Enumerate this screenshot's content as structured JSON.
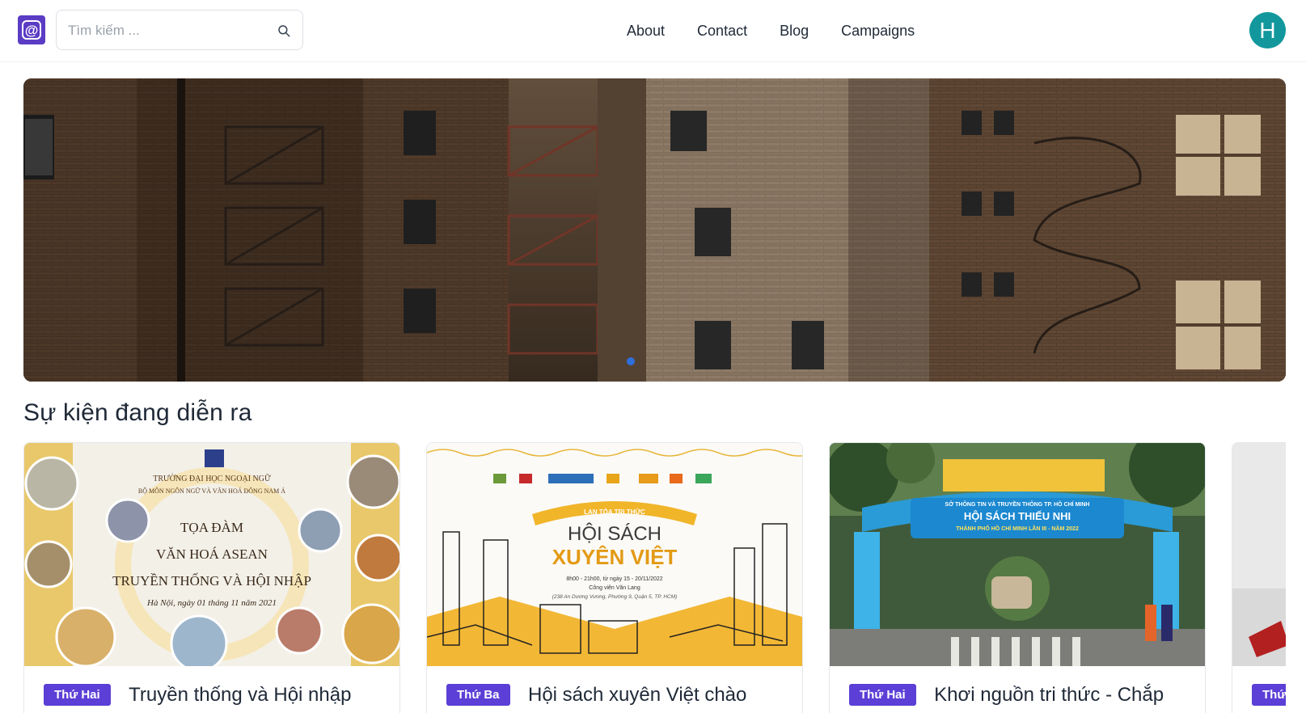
{
  "header": {
    "logo_symbol": "@",
    "search_placeholder": "Tìm kiếm ...",
    "nav": [
      "About",
      "Contact",
      "Blog",
      "Campaigns"
    ],
    "avatar_initial": "H",
    "brand_color": "#5b3cc4",
    "avatar_color": "#12989c"
  },
  "hero": {
    "image": "brick-apartment-buildings-fire-escapes",
    "active_slide": 1
  },
  "section": {
    "title": "Sự kiện đang diễn ra"
  },
  "cards": [
    {
      "day": "Thứ Hai",
      "title": "Truyền thống và Hội nhập",
      "poster": {
        "school": "TRƯỜNG ĐẠI HỌC NGOẠI NGỮ",
        "dept": "BỘ MÔN NGÔN NGỮ VÀ VĂN HOÁ ĐÔNG NAM Á",
        "line1": "TỌA ĐÀM",
        "line2": "VĂN HOÁ ASEAN",
        "line3": "TRUYỀN THỐNG VÀ HỘI NHẬP",
        "date": "Hà Nội, ngày 01 tháng 11 năm 2021"
      }
    },
    {
      "day": "Thứ Ba",
      "title": "Hội sách xuyên Việt chào",
      "poster": {
        "tag": "LAN TỎA TRI THỨC",
        "line1": "HỘI SÁCH",
        "line2": "XUYÊN VIỆT",
        "time": "8h00 - 21h00, từ ngày 15 - 20/11/2022",
        "place": "Công viên Văn Lang",
        "address": "(238 An Dương Vương, Phường 9, Quận 5, TP. HCM)"
      }
    },
    {
      "day": "Thứ Hai",
      "title": "Khơi nguồn tri thức - Chắp",
      "poster": {
        "org": "SỞ THÔNG TIN VÀ TRUYỀN THÔNG TP. HỒ CHÍ MINH",
        "line1": "HỘI SÁCH THIẾU NHI",
        "line2": "THÀNH PHỐ HỒ CHÍ MINH LẦN III - NĂM 2022"
      }
    },
    {
      "day": "Thứ",
      "title": ""
    }
  ]
}
